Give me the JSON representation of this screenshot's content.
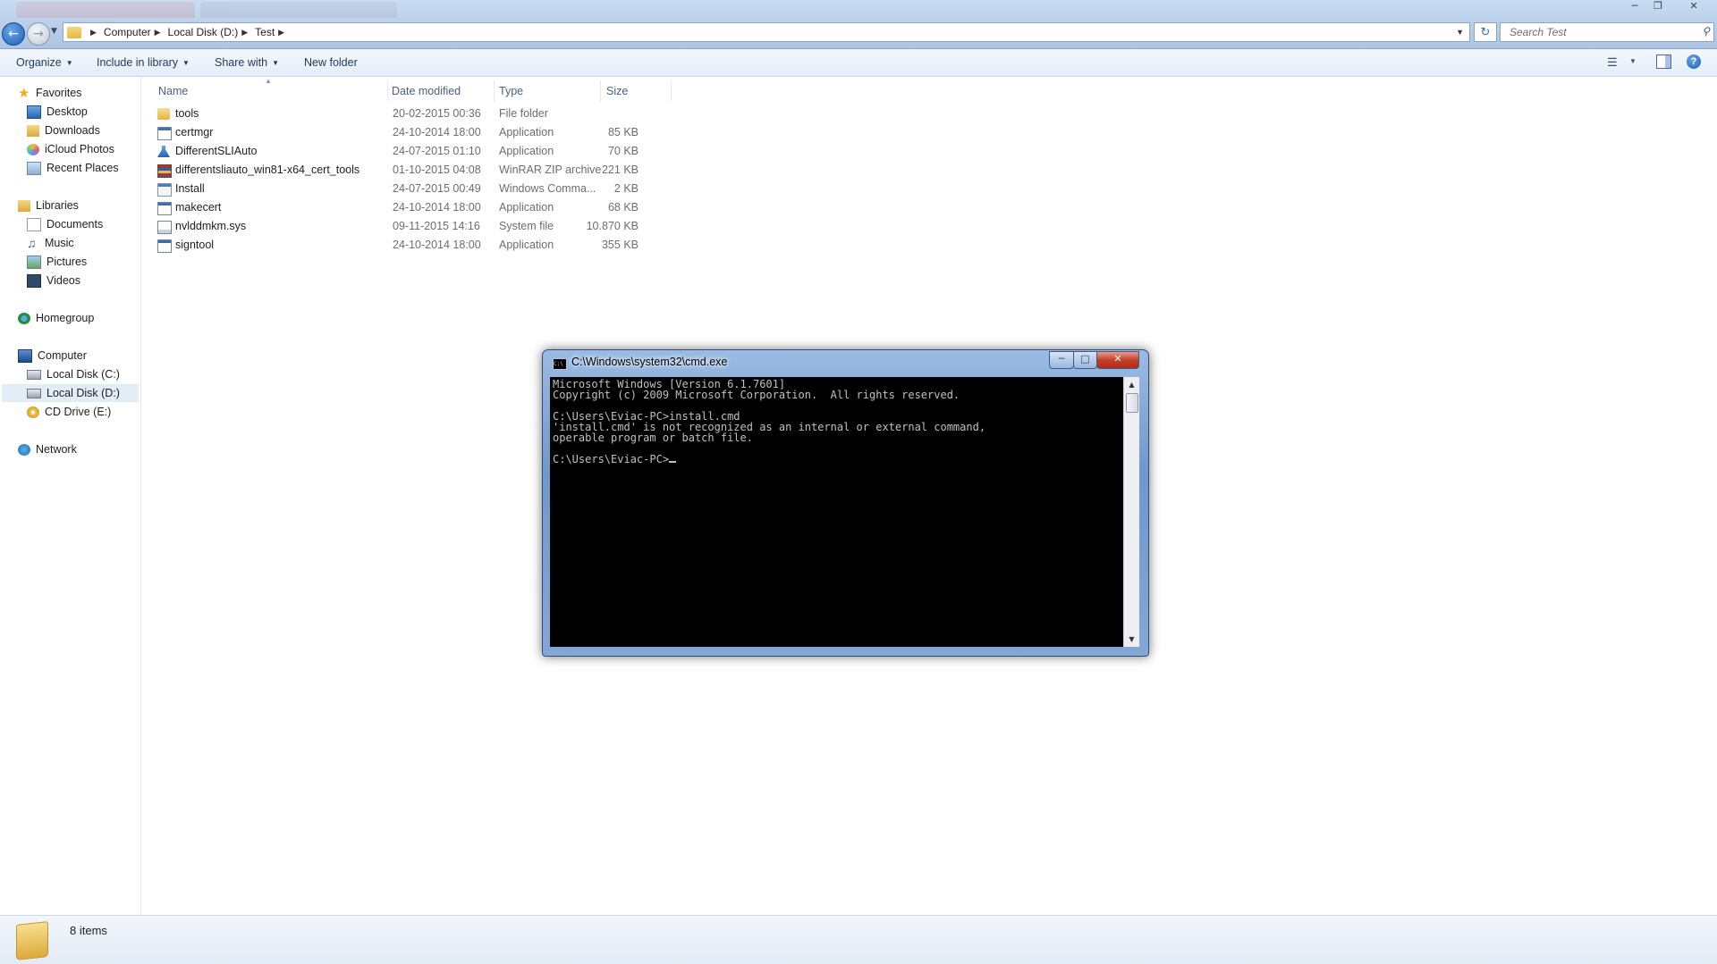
{
  "explorer": {
    "breadcrumb": [
      "Computer",
      "Local Disk (D:)",
      "Test"
    ],
    "search_placeholder": "Search Test",
    "toolbar": {
      "organize": "Organize",
      "include_in_library": "Include in library",
      "share_with": "Share with",
      "new_folder": "New folder"
    },
    "nav": {
      "favorites": {
        "label": "Favorites",
        "items": [
          "Desktop",
          "Downloads",
          "iCloud Photos",
          "Recent Places"
        ]
      },
      "libraries": {
        "label": "Libraries",
        "items": [
          "Documents",
          "Music",
          "Pictures",
          "Videos"
        ]
      },
      "homegroup": "Homegroup",
      "computer": {
        "label": "Computer",
        "items": [
          "Local Disk (C:)",
          "Local Disk (D:)",
          "CD Drive (E:)"
        ],
        "selected": "Local Disk (D:)"
      },
      "network": "Network"
    },
    "columns": {
      "name": "Name",
      "date": "Date modified",
      "type": "Type",
      "size": "Size"
    },
    "files": [
      {
        "name": "tools",
        "date": "20-02-2015 00:36",
        "type": "File folder",
        "size": "",
        "icon": "folder-icon"
      },
      {
        "name": "certmgr",
        "date": "24-10-2014 18:00",
        "type": "Application",
        "size": "85 KB",
        "icon": "application-icon"
      },
      {
        "name": "DifferentSLIAuto",
        "date": "24-07-2015 01:10",
        "type": "Application",
        "size": "70 KB",
        "icon": "flask-icon"
      },
      {
        "name": "differentsliauto_win81-x64_cert_tools",
        "date": "01-10-2015 04:08",
        "type": "WinRAR ZIP archive",
        "size": "221 KB",
        "icon": "winrar-archive-icon"
      },
      {
        "name": "Install",
        "date": "24-07-2015 00:49",
        "type": "Windows Comma...",
        "size": "2 KB",
        "icon": "command-script-icon"
      },
      {
        "name": "makecert",
        "date": "24-10-2014 18:00",
        "type": "Application",
        "size": "68 KB",
        "icon": "application-icon"
      },
      {
        "name": "nvlddmkm.sys",
        "date": "09-11-2015 14:16",
        "type": "System file",
        "size": "10.870 KB",
        "icon": "system-file-icon"
      },
      {
        "name": "signtool",
        "date": "24-10-2014 18:00",
        "type": "Application",
        "size": "355 KB",
        "icon": "application-icon"
      }
    ],
    "status": "8 items"
  },
  "console": {
    "title": "C:\\Windows\\system32\\cmd.exe",
    "lines": [
      "Microsoft Windows [Version 6.1.7601]",
      "Copyright (c) 2009 Microsoft Corporation.  All rights reserved.",
      "",
      "C:\\Users\\Eviac-PC>install.cmd",
      "'install.cmd' is not recognized as an internal or external command,",
      "operable program or batch file.",
      "",
      "C:\\Users\\Eviac-PC>"
    ]
  }
}
